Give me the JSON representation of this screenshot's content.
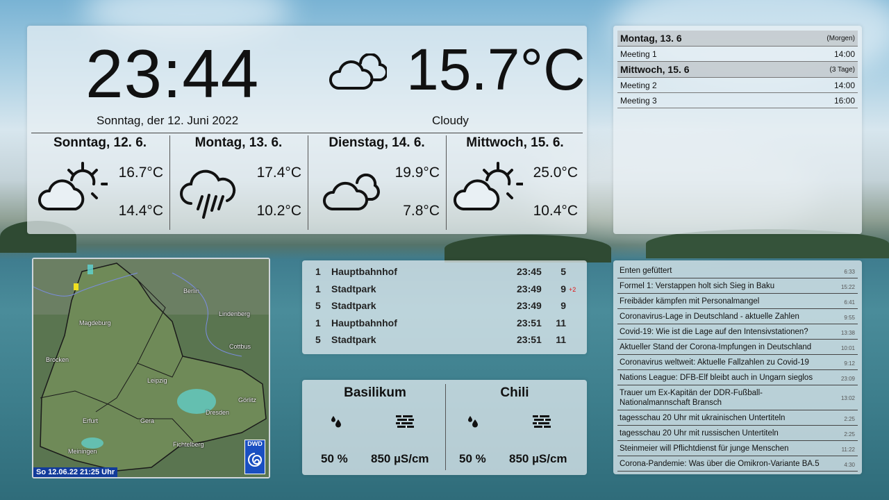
{
  "clock": {
    "time": "23:44",
    "date": "Sonntag, der 12. Juni 2022"
  },
  "current": {
    "temp": "15.7°C",
    "condition": "Cloudy",
    "icon": "cloudy-icon"
  },
  "forecast": [
    {
      "day": "Sonntag, 12. 6.",
      "high": "16.7°C",
      "low": "14.4°C",
      "icon": "partly-cloudy-icon"
    },
    {
      "day": "Montag, 13. 6.",
      "high": "17.4°C",
      "low": "10.2°C",
      "icon": "rain-icon"
    },
    {
      "day": "Dienstag, 14. 6.",
      "high": "19.9°C",
      "low": "7.8°C",
      "icon": "cloudy-icon"
    },
    {
      "day": "Mittwoch, 15. 6.",
      "high": "25.0°C",
      "low": "10.4°C",
      "icon": "partly-cloudy-icon"
    }
  ],
  "calendar": {
    "groups": [
      {
        "day": "Montag, 13. 6",
        "note": "(Morgen)",
        "events": [
          {
            "title": "Meeting 1",
            "time": "14:00"
          }
        ]
      },
      {
        "day": "Mittwoch, 15. 6",
        "note": "(3 Tage)",
        "events": [
          {
            "title": "Meeting 2",
            "time": "14:00"
          },
          {
            "title": "Meeting 3",
            "time": "16:00"
          }
        ]
      }
    ]
  },
  "radar": {
    "cities": [
      "Berlin",
      "Magdeburg",
      "Lindenberg",
      "Cottbus",
      "Brocken",
      "Leipzig",
      "Görlitz",
      "Dresden",
      "Erfurt",
      "Gera",
      "Fichtelberg",
      "Meiningen"
    ],
    "timestamp": "So 12.06.22  21:25 Uhr",
    "badge": "DWD"
  },
  "transit": [
    {
      "line": "1",
      "stop": "Hauptbahnhof",
      "time": "23:45",
      "minutes": "5",
      "delay": ""
    },
    {
      "line": "1",
      "stop": "Stadtpark",
      "time": "23:49",
      "minutes": "9",
      "delay": "+2"
    },
    {
      "line": "5",
      "stop": "Stadtpark",
      "time": "23:49",
      "minutes": "9",
      "delay": ""
    },
    {
      "line": "1",
      "stop": "Hauptbahnhof",
      "time": "23:51",
      "minutes": "11",
      "delay": ""
    },
    {
      "line": "5",
      "stop": "Stadtpark",
      "time": "23:51",
      "minutes": "11",
      "delay": ""
    }
  ],
  "plants": [
    {
      "name": "Basilikum",
      "moisture": "50 %",
      "conductivity": "850 µS/cm"
    },
    {
      "name": "Chili",
      "moisture": "50 %",
      "conductivity": "850 µS/cm"
    }
  ],
  "news": [
    {
      "title": "Enten gefüttert",
      "time": "6:33"
    },
    {
      "title": "Formel 1: Verstappen holt sich Sieg in Baku",
      "time": "15:22"
    },
    {
      "title": "Freibäder kämpfen mit Personalmangel",
      "time": "6:41"
    },
    {
      "title": "Coronavirus-Lage in Deutschland - aktuelle Zahlen",
      "time": "9:55"
    },
    {
      "title": "Covid-19: Wie ist die Lage auf den Intensivstationen?",
      "time": "13:38"
    },
    {
      "title": "Aktueller Stand der Corona-Impfungen in Deutschland",
      "time": "10:01"
    },
    {
      "title": "Coronavirus weltweit: Aktuelle Fallzahlen zu Covid-19",
      "time": "9:12"
    },
    {
      "title": "Nations League: DFB-Elf bleibt auch in Ungarn sieglos",
      "time": "23:09"
    },
    {
      "title": "Trauer um Ex-Kapitän der DDR-Fußball-Nationalmannschaft Bransch",
      "time": "13:02"
    },
    {
      "title": "tagesschau 20 Uhr mit ukrainischen Untertiteln",
      "time": "2:25"
    },
    {
      "title": "tagesschau 20 Uhr mit russischen Untertiteln",
      "time": "2:25"
    },
    {
      "title": "Steinmeier will Pflichtdienst für junge Menschen",
      "time": "11:22"
    },
    {
      "title": "Corona-Pandemie: Was über die Omikron-Variante BA.5",
      "time": "4:30"
    }
  ]
}
